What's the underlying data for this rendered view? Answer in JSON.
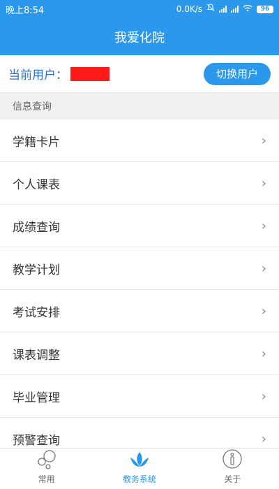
{
  "status_bar": {
    "time": "晚上8:54",
    "speed": "0.0K/s",
    "battery": "96",
    "icons": [
      "mute-bell-icon",
      "signal-icon",
      "signal-icon",
      "wifi-icon",
      "battery-icon"
    ]
  },
  "header": {
    "title": "我爱化院"
  },
  "user": {
    "label": "当前用户：",
    "switch_label": "切换用户"
  },
  "section": {
    "title": "信息查询"
  },
  "menu": {
    "items": [
      {
        "label": "学籍卡片"
      },
      {
        "label": "个人课表"
      },
      {
        "label": "成绩查询"
      },
      {
        "label": "教学计划"
      },
      {
        "label": "考试安排"
      },
      {
        "label": "课表调整"
      },
      {
        "label": "毕业管理"
      },
      {
        "label": "预警查询"
      }
    ],
    "chevron": "›"
  },
  "bottom_nav": {
    "items": [
      {
        "label": "常用",
        "icon": "bubbles-icon"
      },
      {
        "label": "教务系统",
        "icon": "lotus-icon",
        "active": true
      },
      {
        "label": "关于",
        "icon": "info-icon"
      }
    ]
  },
  "colors": {
    "primary": "#2b98ec",
    "user_label": "#2b6fd6",
    "redaction": "#ff1a1a"
  }
}
